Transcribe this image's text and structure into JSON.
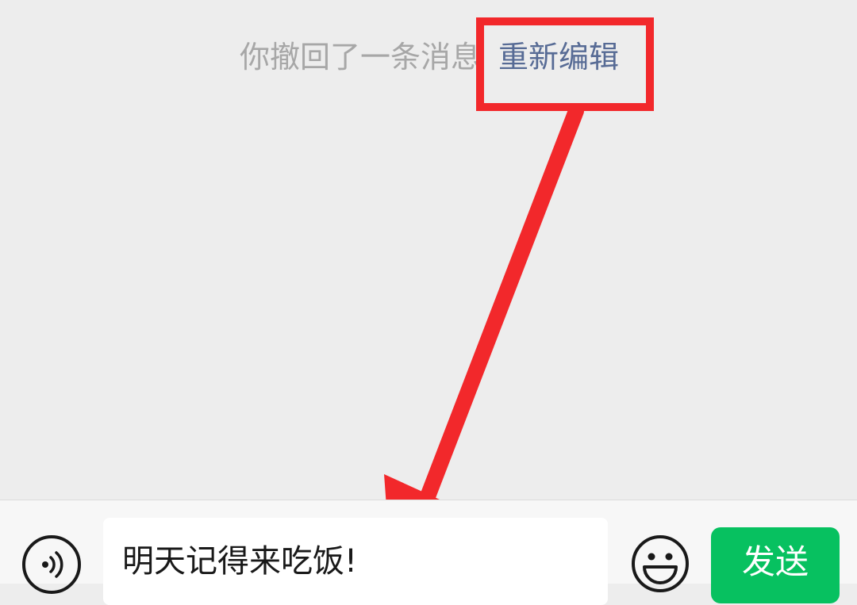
{
  "chat": {
    "recall_notice": "你撤回了一条消息",
    "reedit_label": "重新编辑"
  },
  "input_bar": {
    "message_text": "明天记得来吃饭!",
    "send_label": "发送"
  },
  "icons": {
    "voice": "voice-icon",
    "emoji": "emoji-icon"
  },
  "colors": {
    "background": "#ededed",
    "recall_text": "#a7a7a7",
    "link": "#576b95",
    "send_button": "#07c160",
    "annotation": "#f2282b"
  }
}
